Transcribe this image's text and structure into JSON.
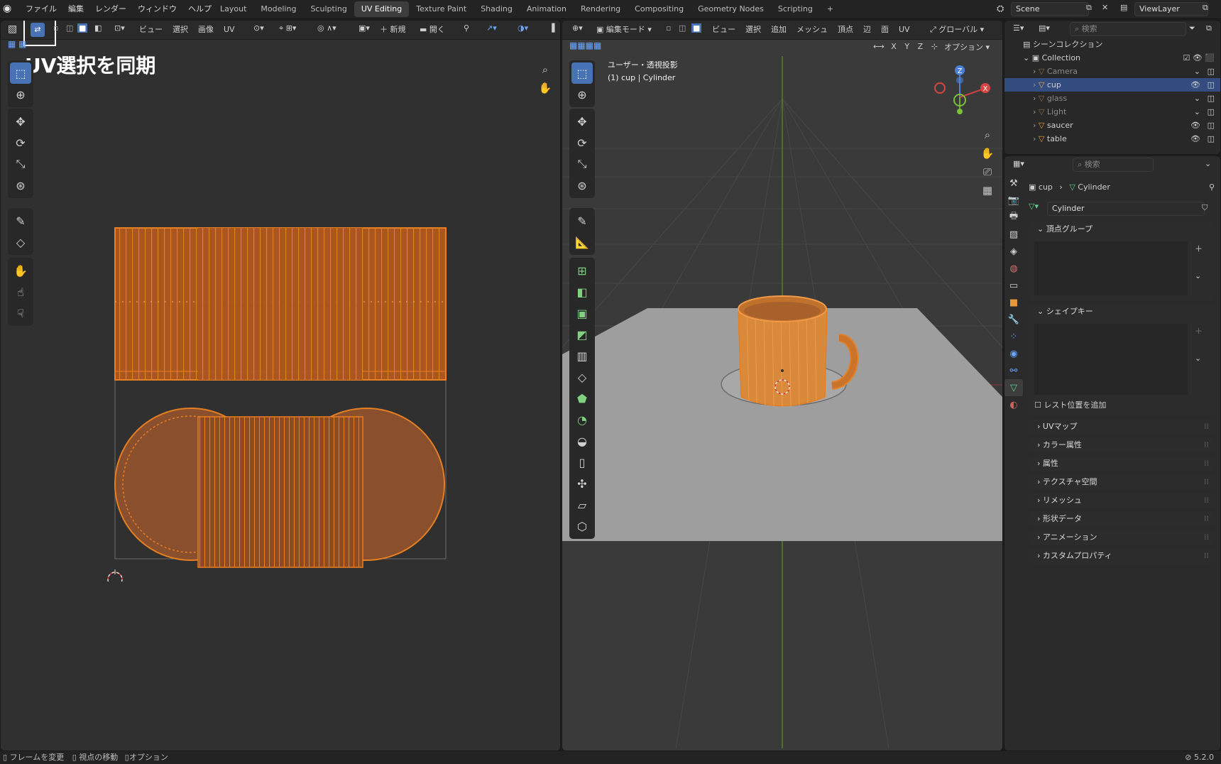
{
  "menu": [
    "ファイル",
    "編集",
    "レンダー",
    "ウィンドウ",
    "ヘルプ"
  ],
  "workspaces": [
    "Layout",
    "Modeling",
    "Sculpting",
    "UV Editing",
    "Texture Paint",
    "Shading",
    "Animation",
    "Rendering",
    "Compositing",
    "Geometry Nodes",
    "Scripting",
    "+"
  ],
  "active_workspace": "UV Editing",
  "scene": {
    "label": "Scene",
    "viewlayer": "ViewLayer"
  },
  "uv_editor": {
    "menus": [
      "ビュー",
      "選択",
      "画像",
      "UV"
    ],
    "new_label": "新規",
    "open_label": "開く",
    "callout": "UV選択を同期"
  },
  "viewport": {
    "mode": "編集モード",
    "menus": [
      "ビュー",
      "選択",
      "追加",
      "メッシュ",
      "頂点",
      "辺",
      "面",
      "UV"
    ],
    "transform": "グローバル",
    "options": "オプション",
    "axes": [
      "X",
      "Y",
      "Z"
    ],
    "overlay_line1": "ユーザー・透視投影",
    "overlay_line2": "(1) cup | Cylinder",
    "gizmo": {
      "z": "Z",
      "x": "X",
      "y": "Y"
    }
  },
  "outliner": {
    "search_placeholder": "検索",
    "root": "シーンコレクション",
    "collection": "Collection",
    "items": [
      {
        "name": "Camera",
        "selected": false,
        "dim": true
      },
      {
        "name": "cup",
        "selected": true,
        "dim": false
      },
      {
        "name": "glass",
        "selected": false,
        "dim": true
      },
      {
        "name": "Light",
        "selected": false,
        "dim": true
      },
      {
        "name": "saucer",
        "selected": false,
        "dim": false
      },
      {
        "name": "table",
        "selected": false,
        "dim": false
      }
    ]
  },
  "properties": {
    "search_placeholder": "検索",
    "breadcrumb_object": "cup",
    "breadcrumb_data": "Cylinder",
    "mesh_name": "Cylinder",
    "panels_open": [
      "頂点グループ",
      "シェイプキー"
    ],
    "relative_label": "レスト位置を追加",
    "panels_closed": [
      "UVマップ",
      "カラー属性",
      "属性",
      "テクスチャ空間",
      "リメッシュ",
      "形状データ",
      "アニメーション",
      "カスタムプロパティ"
    ]
  },
  "status": {
    "items": [
      "フレームを変更",
      "視点の移動",
      "オプション"
    ],
    "version": "5.2.0"
  },
  "colors": {
    "accent": "#4772b3",
    "uv_orange": "#e67e22",
    "face_fill": "#8a4f2c",
    "selection": "#334d80"
  }
}
